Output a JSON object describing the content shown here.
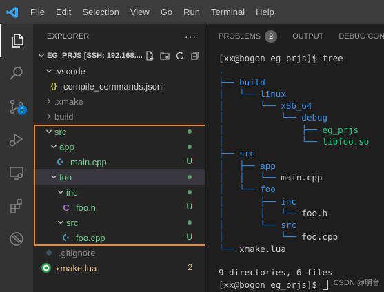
{
  "menu": [
    "File",
    "Edit",
    "Selection",
    "View",
    "Go",
    "Run",
    "Terminal",
    "Help"
  ],
  "activity": {
    "scm_badge": "6"
  },
  "explorer": {
    "title": "EXPLORER",
    "more": "···",
    "workspace": "EG_PRJS [SSH: 192.168...."
  },
  "tree": [
    {
      "label": "src",
      "status": ""
    },
    {
      "label": "app",
      "status": ""
    },
    {
      "label": "main.cpp",
      "status": "U"
    },
    {
      "label": "foo",
      "status": ""
    },
    {
      "label": "inc",
      "status": ""
    },
    {
      "label": "foo.h",
      "status": "U"
    },
    {
      "label": "src",
      "status": ""
    },
    {
      "label": "foo.cpp",
      "status": "U"
    }
  ],
  "tree_extra": {
    "vscode": ".vscode",
    "compile_commands": "compile_commands.json",
    "xmake_dir": ".xmake",
    "build": "build",
    "gitignore": ".gitignore",
    "xmake_lua": "xmake.lua",
    "xmake_lua_status": "2"
  },
  "panel": {
    "problems": "PROBLEMS",
    "problems_count": "2",
    "output": "OUTPUT",
    "debug_console": "DEBUG CONSOLE"
  },
  "terminal": {
    "prompt1": "[xx@bogon eg_prjs]$ tree",
    "root": ".",
    "build": "build",
    "linux": "linux",
    "x86_64": "x86_64",
    "debug": "debug",
    "eg_prjs": "eg_prjs",
    "libfoo": "libfoo.so",
    "src": "src",
    "app": "app",
    "main_cpp": "main.cpp",
    "foo": "foo",
    "inc": "inc",
    "foo_h": "foo.h",
    "src2": "src",
    "foo_cpp": "foo.cpp",
    "xmake_lua": "xmake.lua",
    "summary": "9 directories, 6 files",
    "prompt2": "[xx@bogon eg_prjs]$ "
  },
  "watermark": "CSDN @明台",
  "colors": {
    "accent": "#007acc",
    "highlight_box": "#f0882c",
    "untracked": "#73c991",
    "modified": "#e2c08d",
    "dir": "#3b8eea",
    "exe": "#23d18b"
  }
}
